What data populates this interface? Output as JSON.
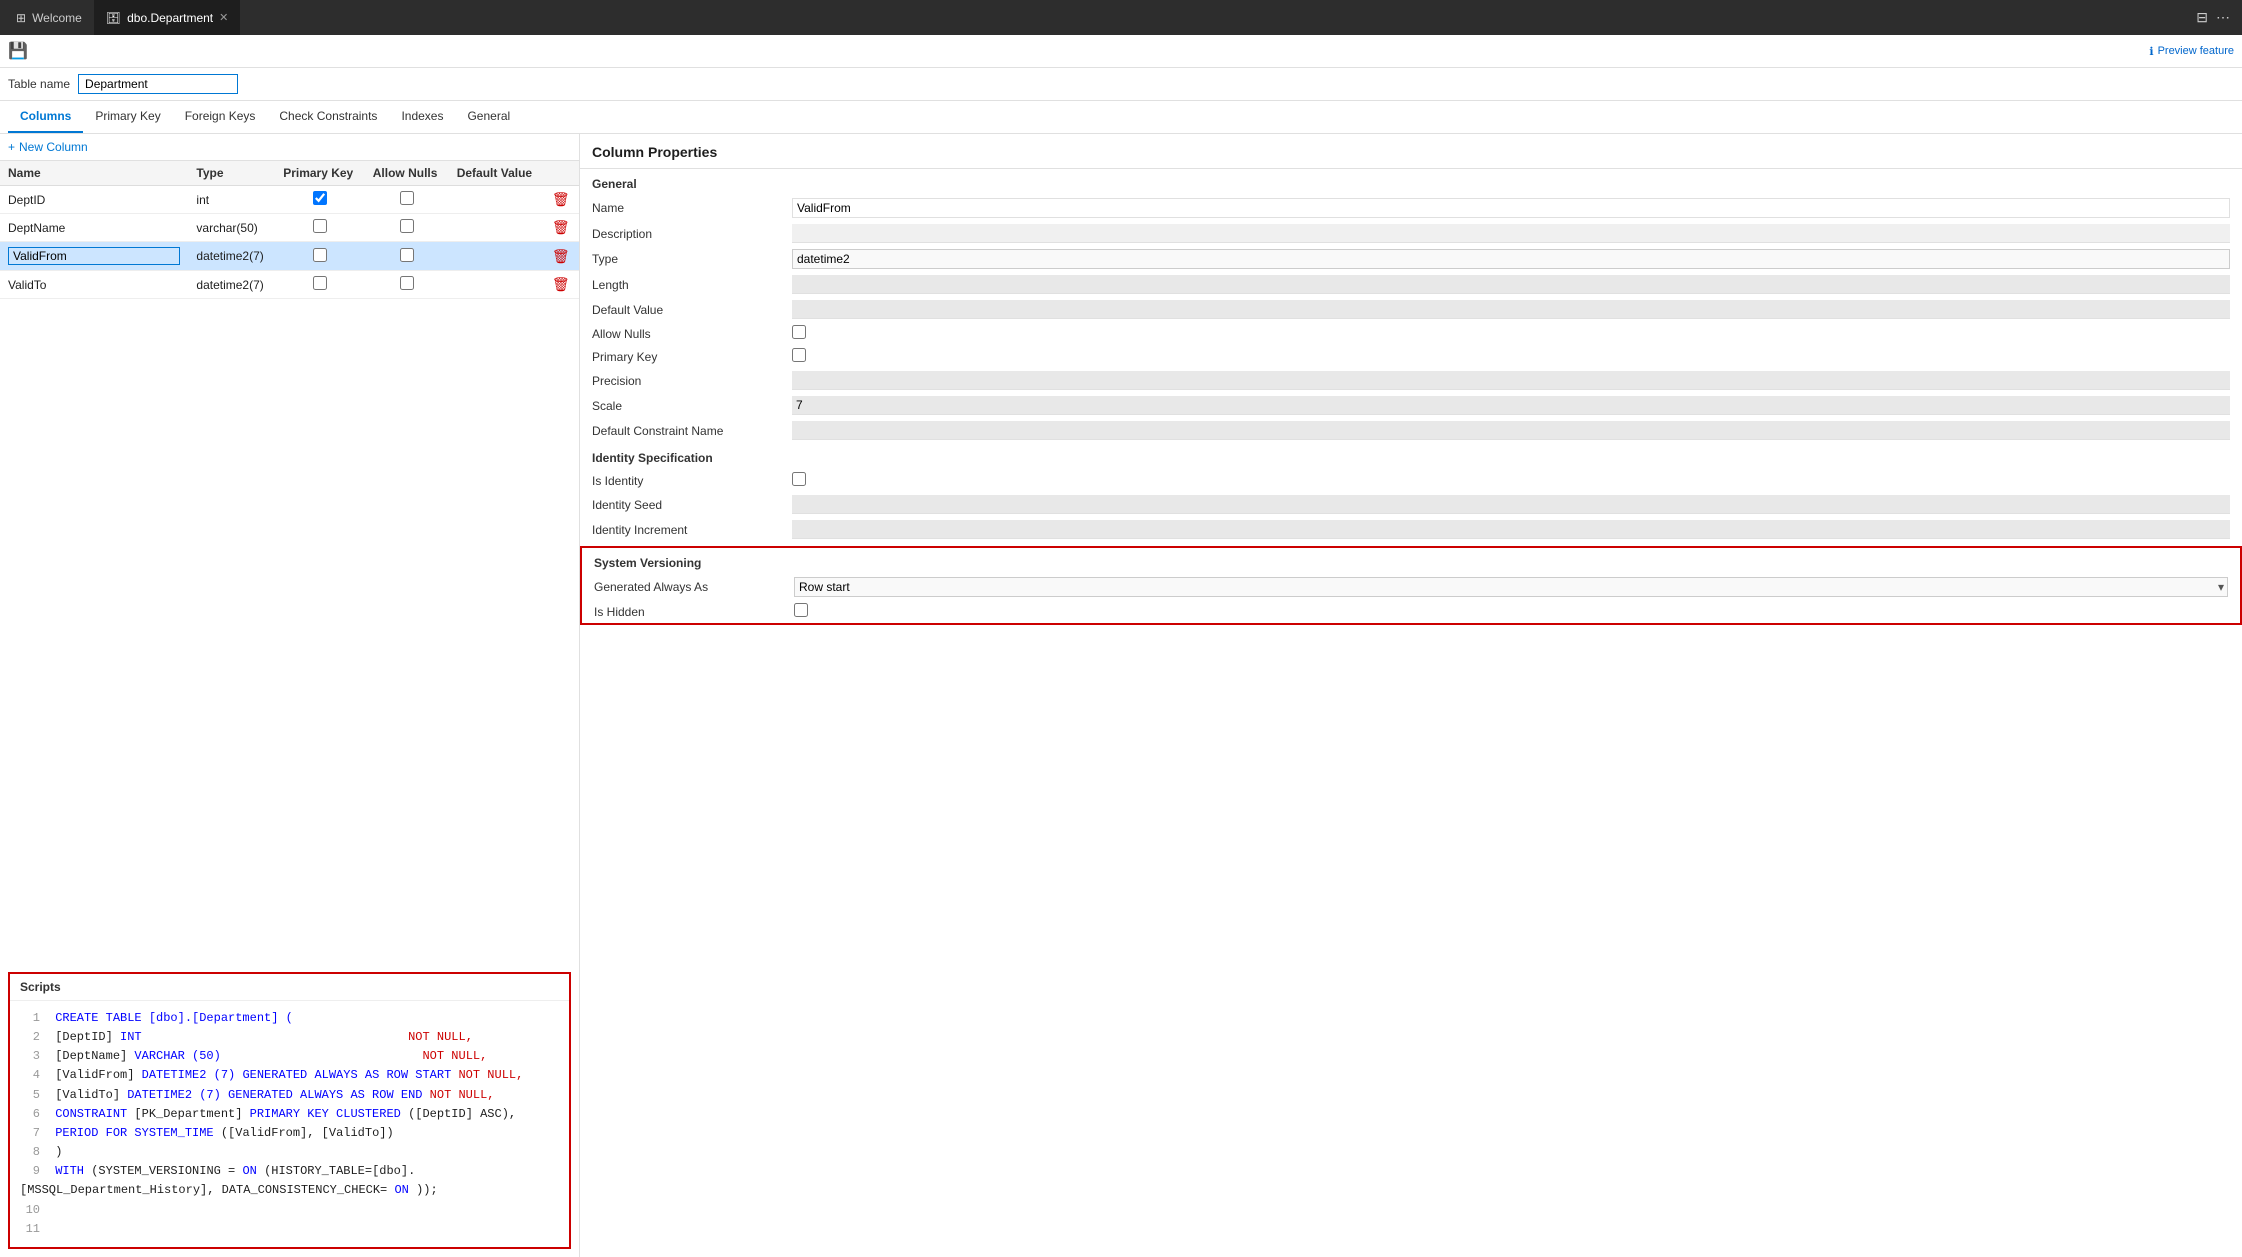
{
  "tabs": {
    "welcome": {
      "label": "Welcome",
      "icon": "⊞"
    },
    "table": {
      "label": "dbo.Department",
      "icon": "🗄"
    },
    "active": "table"
  },
  "toolbar": {
    "preview_feature": "Preview feature",
    "preview_icon": "ℹ"
  },
  "table_name": {
    "label": "Table name",
    "value": "Department"
  },
  "nav_tabs": [
    {
      "id": "columns",
      "label": "Columns",
      "active": true
    },
    {
      "id": "primary-key",
      "label": "Primary Key",
      "active": false
    },
    {
      "id": "foreign-keys",
      "label": "Foreign Keys",
      "active": false
    },
    {
      "id": "check-constraints",
      "label": "Check Constraints",
      "active": false
    },
    {
      "id": "indexes",
      "label": "Indexes",
      "active": false
    },
    {
      "id": "general",
      "label": "General",
      "active": false
    }
  ],
  "new_column_btn": "+ New Column",
  "columns_table": {
    "headers": [
      "Name",
      "Type",
      "Primary Key",
      "Allow Nulls",
      "Default Value",
      ""
    ],
    "rows": [
      {
        "name": "DeptID",
        "type": "int",
        "primary_key": true,
        "allow_nulls": false,
        "default_value": "",
        "selected": false
      },
      {
        "name": "DeptName",
        "type": "varchar(50)",
        "primary_key": false,
        "allow_nulls": false,
        "default_value": "",
        "selected": false
      },
      {
        "name": "ValidFrom",
        "type": "datetime2(7)",
        "primary_key": false,
        "allow_nulls": false,
        "default_value": "",
        "selected": true,
        "editing": true
      },
      {
        "name": "ValidTo",
        "type": "datetime2(7)",
        "primary_key": false,
        "allow_nulls": false,
        "default_value": "",
        "selected": false
      }
    ]
  },
  "column_properties": {
    "title": "Column Properties",
    "general_title": "General",
    "fields": [
      {
        "label": "Name",
        "value": "ValidFrom",
        "type": "input_white"
      },
      {
        "label": "Description",
        "value": "",
        "type": "input_gray"
      },
      {
        "label": "Type",
        "value": "datetime2",
        "type": "select"
      },
      {
        "label": "Length",
        "value": "",
        "type": "input_gray"
      },
      {
        "label": "Default Value",
        "value": "",
        "type": "input_gray"
      },
      {
        "label": "Allow Nulls",
        "value": "",
        "type": "checkbox"
      },
      {
        "label": "Primary Key",
        "value": "",
        "type": "checkbox"
      },
      {
        "label": "Precision",
        "value": "",
        "type": "input_gray"
      },
      {
        "label": "Scale",
        "value": "7",
        "type": "input_gray"
      },
      {
        "label": "Default Constraint Name",
        "value": "",
        "type": "input_gray"
      }
    ],
    "identity_title": "Identity Specification",
    "identity_fields": [
      {
        "label": "Is Identity",
        "value": "",
        "type": "checkbox"
      },
      {
        "label": "Identity Seed",
        "value": "",
        "type": "input_gray"
      },
      {
        "label": "Identity Increment",
        "value": "",
        "type": "input_gray"
      }
    ],
    "sys_versioning_title": "System Versioning",
    "sys_versioning_fields": [
      {
        "label": "Generated Always As",
        "value": "Row start",
        "type": "select_dropdown"
      },
      {
        "label": "Is Hidden",
        "value": "",
        "type": "checkbox"
      }
    ]
  },
  "scripts": {
    "title": "Scripts",
    "lines": [
      {
        "num": 1,
        "parts": [
          {
            "text": "CREATE TABLE [dbo].[Department] (",
            "class": "kw-blue"
          }
        ]
      },
      {
        "num": 2,
        "parts": [
          {
            "text": "    [DeptID]    INT                                    ",
            "class": "kw-black"
          },
          {
            "text": "NOT NULL,",
            "class": "not-null-red"
          }
        ]
      },
      {
        "num": 3,
        "parts": [
          {
            "text": "    [DeptName]  VARCHAR (50)                            ",
            "class": "kw-black"
          },
          {
            "text": "NOT NULL,",
            "class": "not-null-red"
          }
        ]
      },
      {
        "num": 4,
        "parts": [
          {
            "text": "    [ValidFrom] DATETIME2 (7) GENERATED ALWAYS AS ROW START ",
            "class": "kw-black"
          },
          {
            "text": "NOT NULL,",
            "class": "not-null-red"
          }
        ]
      },
      {
        "num": 5,
        "parts": [
          {
            "text": "    [ValidTo]   DATETIME2 (7) GENERATED ALWAYS AS ROW END   ",
            "class": "kw-black"
          },
          {
            "text": "NOT NULL,",
            "class": "not-null-red"
          }
        ]
      },
      {
        "num": 6,
        "parts": [
          {
            "text": "    ",
            "class": "kw-black"
          },
          {
            "text": "CONSTRAINT",
            "class": "kw-blue"
          },
          {
            "text": " [PK_Department] PRIMARY KEY CLUSTERED ([DeptID] ASC),",
            "class": "kw-black"
          }
        ]
      },
      {
        "num": 7,
        "parts": [
          {
            "text": "    PERIOD FOR SYSTEM_TIME ([ValidFrom], [ValidTo])",
            "class": "kw-black"
          }
        ]
      },
      {
        "num": 8,
        "parts": [
          {
            "text": ")",
            "class": "kw-black"
          }
        ]
      },
      {
        "num": 9,
        "parts": [
          {
            "text": "WITH (SYSTEM_VERSIONING = ON (HISTORY_TABLE=[dbo].[MSSQL_Department_History], DATA_CONSISTENCY_CHECK=ON));",
            "class": "kw-black"
          }
        ]
      },
      {
        "num": 10,
        "parts": []
      },
      {
        "num": 11,
        "parts": []
      }
    ]
  }
}
